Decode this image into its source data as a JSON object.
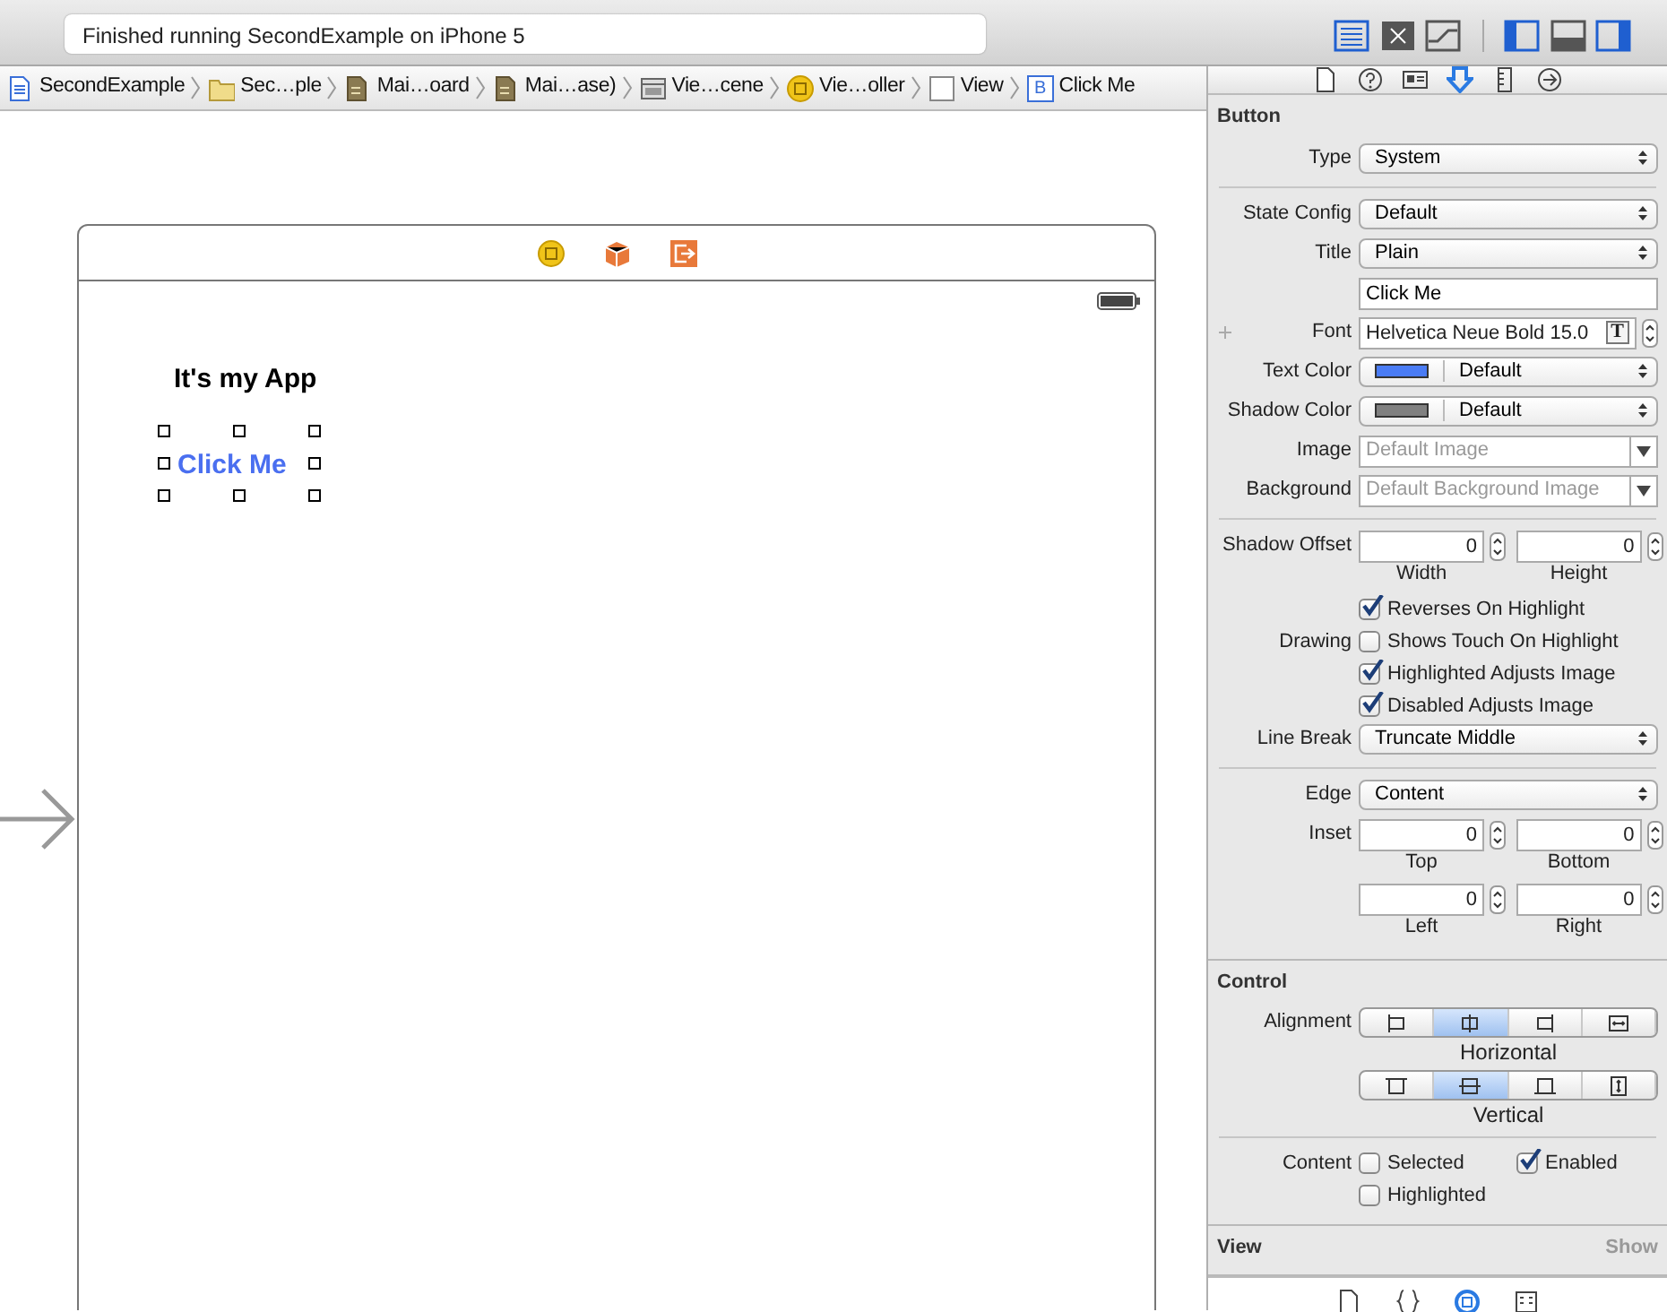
{
  "toolbar": {
    "status": "Finished running SecondExample on iPhone 5",
    "editor_buttons": [
      {
        "selected": true
      },
      {
        "selected": false
      },
      {
        "selected": false
      }
    ],
    "view_buttons": [
      {
        "selected": true
      },
      {
        "selected": false
      },
      {
        "selected": true
      }
    ]
  },
  "breadcrumbs": [
    {
      "label": "SecondExample",
      "kind": "project"
    },
    {
      "label": "Sec…ple",
      "kind": "folder"
    },
    {
      "label": "Mai…oard",
      "kind": "storyboard"
    },
    {
      "label": "Mai…ase)",
      "kind": "storyboard"
    },
    {
      "label": "Vie…cene",
      "kind": "scene"
    },
    {
      "label": "Vie…oller",
      "kind": "controller"
    },
    {
      "label": "View",
      "kind": "view"
    },
    {
      "label": "Click Me",
      "kind": "button",
      "glyph": "B"
    }
  ],
  "canvas": {
    "label": "It's my App",
    "button": {
      "title": "Click Me",
      "selected": true
    }
  },
  "inspector_tabs": [
    {
      "selected": false
    },
    {
      "selected": false
    },
    {
      "selected": false
    },
    {
      "selected": true
    },
    {
      "selected": false
    },
    {
      "selected": false
    }
  ],
  "sections": [
    {
      "title": "Button",
      "rows": [
        {
          "kind": "popup",
          "label": "Type",
          "value": "System"
        },
        {
          "kind": "separator"
        },
        {
          "kind": "popup",
          "label": "State Config",
          "value": "Default"
        },
        {
          "kind": "popup",
          "label": "Title",
          "value": "Plain"
        },
        {
          "kind": "text",
          "value": "Click Me"
        },
        {
          "kind": "font",
          "label": "Font",
          "value": "Helvetica Neue Bold 15.0",
          "glyph": "T"
        },
        {
          "kind": "color",
          "label": "Text Color",
          "color": "#4a7cf5",
          "value": "Default"
        },
        {
          "kind": "color",
          "label": "Shadow Color",
          "color": "#808080",
          "value": "Default"
        },
        {
          "kind": "combo",
          "label": "Image",
          "placeholder": "Default Image"
        },
        {
          "kind": "combo",
          "label": "Background",
          "placeholder": "Default Background Image"
        },
        {
          "kind": "separator"
        },
        {
          "kind": "steppers",
          "label": "Shadow Offset",
          "fields": [
            {
              "value": "0",
              "caption": "Width"
            },
            {
              "value": "0",
              "caption": "Height"
            }
          ]
        },
        {
          "kind": "checkbox",
          "text": "Reverses On Highlight",
          "checked": true
        },
        {
          "kind": "checkbox",
          "label": "Drawing",
          "text": "Shows Touch On Highlight",
          "checked": false
        },
        {
          "kind": "checkbox",
          "text": "Highlighted Adjusts Image",
          "checked": true
        },
        {
          "kind": "checkbox",
          "text": "Disabled Adjusts Image",
          "checked": true
        },
        {
          "kind": "popup",
          "label": "Line Break",
          "value": "Truncate Middle"
        },
        {
          "kind": "separator"
        },
        {
          "kind": "popup",
          "label": "Edge",
          "value": "Content"
        },
        {
          "kind": "steppers",
          "label": "Inset",
          "fields": [
            {
              "value": "0",
              "caption": "Top"
            },
            {
              "value": "0",
              "caption": "Bottom"
            }
          ]
        },
        {
          "kind": "steppers",
          "fields": [
            {
              "value": "0",
              "caption": "Left"
            },
            {
              "value": "0",
              "caption": "Right"
            }
          ]
        }
      ]
    },
    {
      "title": "Control",
      "rows": [
        {
          "kind": "halign",
          "label": "Alignment",
          "caption": "Horizontal",
          "segments": [
            {
              "selected": false
            },
            {
              "selected": true
            },
            {
              "selected": false
            },
            {
              "selected": false
            }
          ]
        },
        {
          "kind": "valign",
          "caption": "Vertical",
          "segments": [
            {
              "selected": false
            },
            {
              "selected": true
            },
            {
              "selected": false
            },
            {
              "selected": false
            }
          ]
        },
        {
          "kind": "separator"
        },
        {
          "kind": "checkboxes",
          "label": "Content",
          "items": [
            {
              "text": "Selected",
              "checked": false
            },
            {
              "text": "Enabled",
              "checked": true
            }
          ]
        },
        {
          "kind": "checkbox",
          "text": "Highlighted",
          "checked": false
        }
      ]
    },
    {
      "title": "View",
      "action": "Show"
    }
  ],
  "library_tabs": [
    {
      "selected": false
    },
    {
      "selected": false
    },
    {
      "selected": true
    },
    {
      "selected": false
    }
  ]
}
